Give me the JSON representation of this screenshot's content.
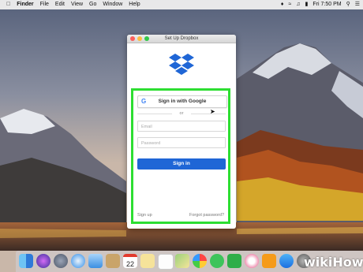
{
  "menubar": {
    "items": [
      "Finder",
      "File",
      "Edit",
      "View",
      "Go",
      "Window",
      "Help"
    ],
    "clock": "Fri 7:50 PM"
  },
  "window": {
    "title": "Set Up Dropbox",
    "google_button": "Sign in with Google",
    "or_text": "or",
    "email_placeholder": "Email",
    "password_placeholder": "Password",
    "signin_button": "Sign in",
    "signup_link": "Sign up",
    "forgot_link": "Forgot password?"
  },
  "watermark": "wikiHow",
  "colors": {
    "highlight": "#2dde32",
    "dropbox_blue": "#1f66d6",
    "button_blue": "#1f66d6"
  },
  "dock": {
    "icons": [
      "finder-icon",
      "siri-icon",
      "launchpad-icon",
      "safari-icon",
      "mail-icon",
      "contacts-icon",
      "calendar-icon",
      "notes-icon",
      "reminders-icon",
      "maps-icon",
      "photos-icon",
      "messages-icon",
      "facetime-icon",
      "itunes-icon",
      "ibooks-icon",
      "app-store-icon",
      "system-preferences-icon"
    ],
    "calendar_day": "22"
  }
}
